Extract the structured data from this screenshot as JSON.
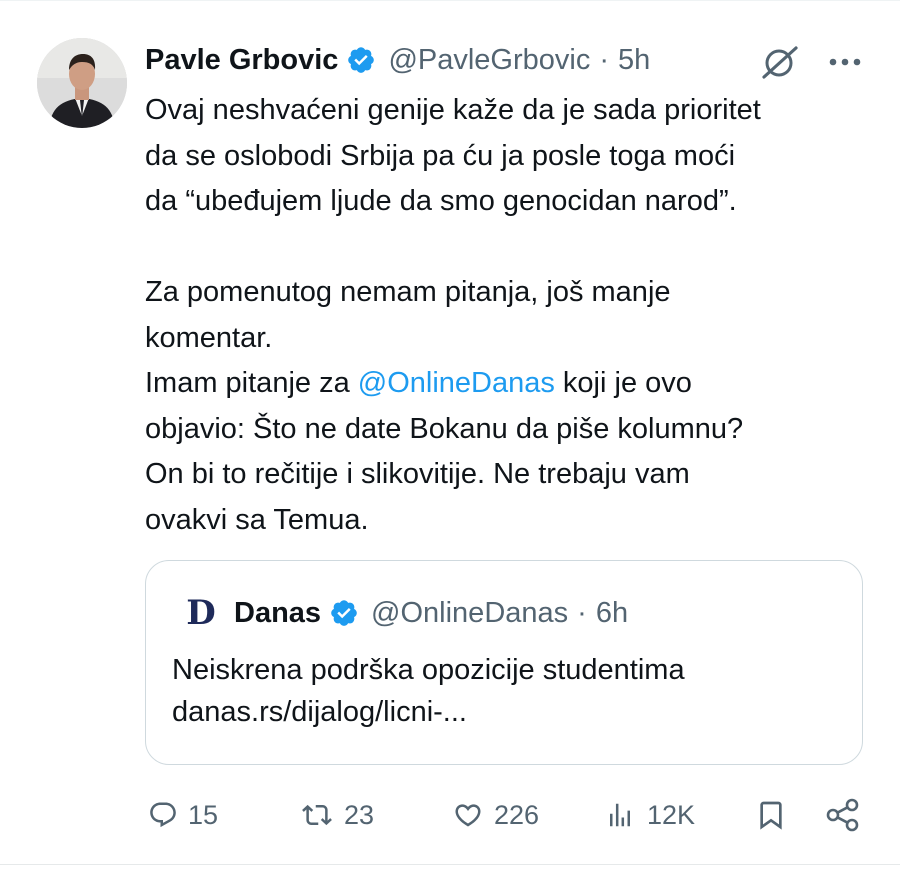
{
  "tweet": {
    "author_name": "Pavle Grbovic",
    "author_handle": "@PavleGrbovic",
    "separator": "·",
    "time": "5h",
    "lines": [
      "Ovaj neshvaćeni genije kaže da je sada prioritet",
      "da se oslobodi Srbija pa ću ja posle toga moći",
      "da “ubeđujem ljude da smo genocidan narod”.",
      "",
      "Za pomenutog nemam pitanja, još manje",
      "komentar."
    ],
    "line7_before": "Imam pitanje za ",
    "line7_mention": "@OnlineDanas",
    "line7_after": " koji je ovo",
    "lines_after": [
      "objavio: Što ne date Bokanu da piše kolumnu?",
      "On bi to rečitije i slikovitije. Ne trebaju vam",
      "ovakvi sa Temua."
    ]
  },
  "quote": {
    "logo_letter": "D",
    "name": "Danas",
    "handle": "@OnlineDanas",
    "separator": "·",
    "time": "6h",
    "line1": "Neiskrena podrška opozicije studentima",
    "line2": "danas.rs/dijalog/licni-..."
  },
  "actions": {
    "replies": "15",
    "reposts": "23",
    "likes": "226",
    "views": "12K"
  },
  "icons": [
    "verified-badge-icon",
    "grok-icon",
    "more-icon",
    "reply-icon",
    "repost-icon",
    "like-icon",
    "views-icon",
    "bookmark-icon",
    "share-icon"
  ],
  "colors": {
    "accent": "#1d9bf0",
    "text": "#0f1419",
    "muted": "#536471",
    "border": "#cfd9de"
  }
}
